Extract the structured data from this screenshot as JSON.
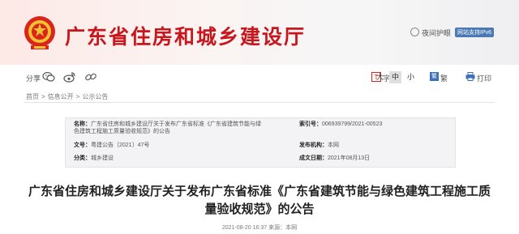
{
  "header": {
    "site_title": "广东省住房和城乡建设厅",
    "night_mode_label": "夜间护眼",
    "ipv6_badge": "网站支持IPv6",
    "emblem_icon": "national-emblem-icon"
  },
  "toolbar": {
    "share_label": "分享",
    "share_icons": [
      "wechat-icon",
      "weibo-icon",
      "link-icon"
    ],
    "font_size_label": "字号",
    "font_sizes": [
      "大",
      "中",
      "小"
    ],
    "font_size_selected": "中",
    "traditional_icon_char": "繁",
    "traditional_label": "繁",
    "print_label": "打印"
  },
  "breadcrumb": {
    "items": [
      "首页",
      "信息公开",
      "公示公告"
    ],
    "separator": ">"
  },
  "meta": {
    "title_label": "名称：",
    "title_value_line1": "广东省住房和城乡建设厅关于发布广东省标准《广东省建筑节能与绿",
    "title_value_line2": "色建筑工程施工质量验收规范》的公告",
    "index_label": "索引号：",
    "index_value": "006939799/2021-00523",
    "docno_label": "文号：",
    "docno_value": "粤建公告〔2021〕47号",
    "publisher_label": "发布机构：",
    "publisher_value": "本网",
    "category_label": "分类：",
    "category_value": "城乡建设",
    "date_label": "成文日期：",
    "date_value": "2021年08月13日"
  },
  "article": {
    "title": "广东省住房和城乡建设厅关于发布广东省标准《广东省建筑节能与绿色建筑工程施工质量验收规范》的公告",
    "pubinfo": "2021-08-20  16:37    来源：本网"
  },
  "colors": {
    "brand_red": "#c8161d",
    "ipv6_blue": "#4a79b3"
  }
}
